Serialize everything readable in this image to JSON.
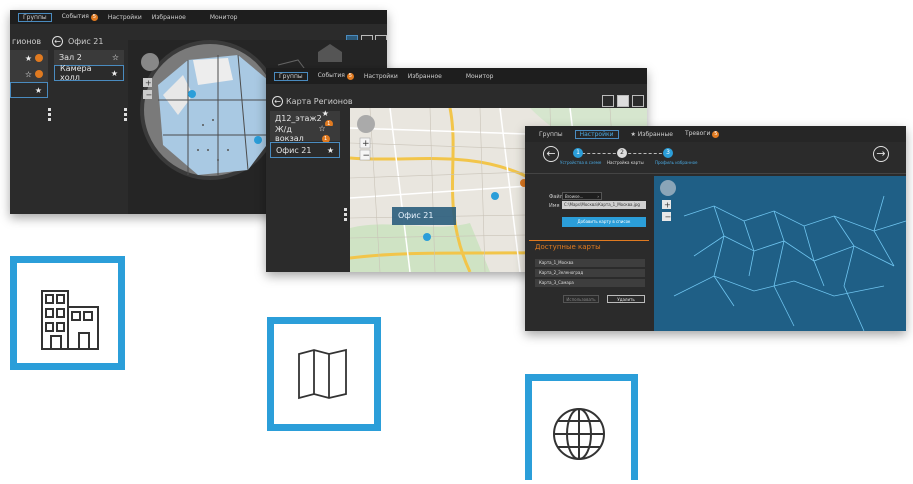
{
  "win1": {
    "tabs": [
      "Группы",
      "События",
      "Настройки",
      "Избранное",
      "Монитор"
    ],
    "events_badge": "5",
    "title": "Офис 21",
    "left_partial_label": "гионов",
    "camera_items": [
      {
        "label": "Зал 2",
        "icon": "star-outline"
      },
      {
        "label": "Камера холл",
        "icon": "star"
      }
    ]
  },
  "win2": {
    "tabs": [
      "Группы",
      "События",
      "Настройки",
      "Избранное",
      "Монитор"
    ],
    "events_badge": "5",
    "title": "Карта Регионов",
    "items": [
      {
        "label": "Д12_этаж2",
        "icon": "star",
        "badge": "1"
      },
      {
        "label": "Ж/д вокзал",
        "icon": "star-outline",
        "badge": "1"
      },
      {
        "label": "Офис 21",
        "icon": "star"
      }
    ],
    "map_label": "Офис 21"
  },
  "win3": {
    "tabs": [
      "Группы",
      "Настройки",
      "Избранные",
      "Тревоги"
    ],
    "alarms_badge": "5",
    "steps": [
      {
        "num": "1",
        "label": "Устройства в схеме"
      },
      {
        "num": "2",
        "label": "Настройка карты"
      },
      {
        "num": "3",
        "label": "Профиль избранное"
      }
    ],
    "file_label": "Файл",
    "file_button": "Browse...",
    "name_label": "Имя",
    "name_value": "C:\\Maps\\Москва\\Карта_1_Москва.jpg",
    "add_button": "Добавить карту в список",
    "available_title": "Доступные карты",
    "maps": [
      "Карта_1_Москва",
      "Карта_2_Зеленоград",
      "Карта_3_Самара"
    ],
    "edit_button": "Использовать",
    "delete_button": "Удалить"
  },
  "colors": {
    "accent_blue": "#2b9ed9",
    "orange": "#e07a20",
    "dark_bg": "#2b2b2b",
    "map_blue": "#1f5f86"
  }
}
